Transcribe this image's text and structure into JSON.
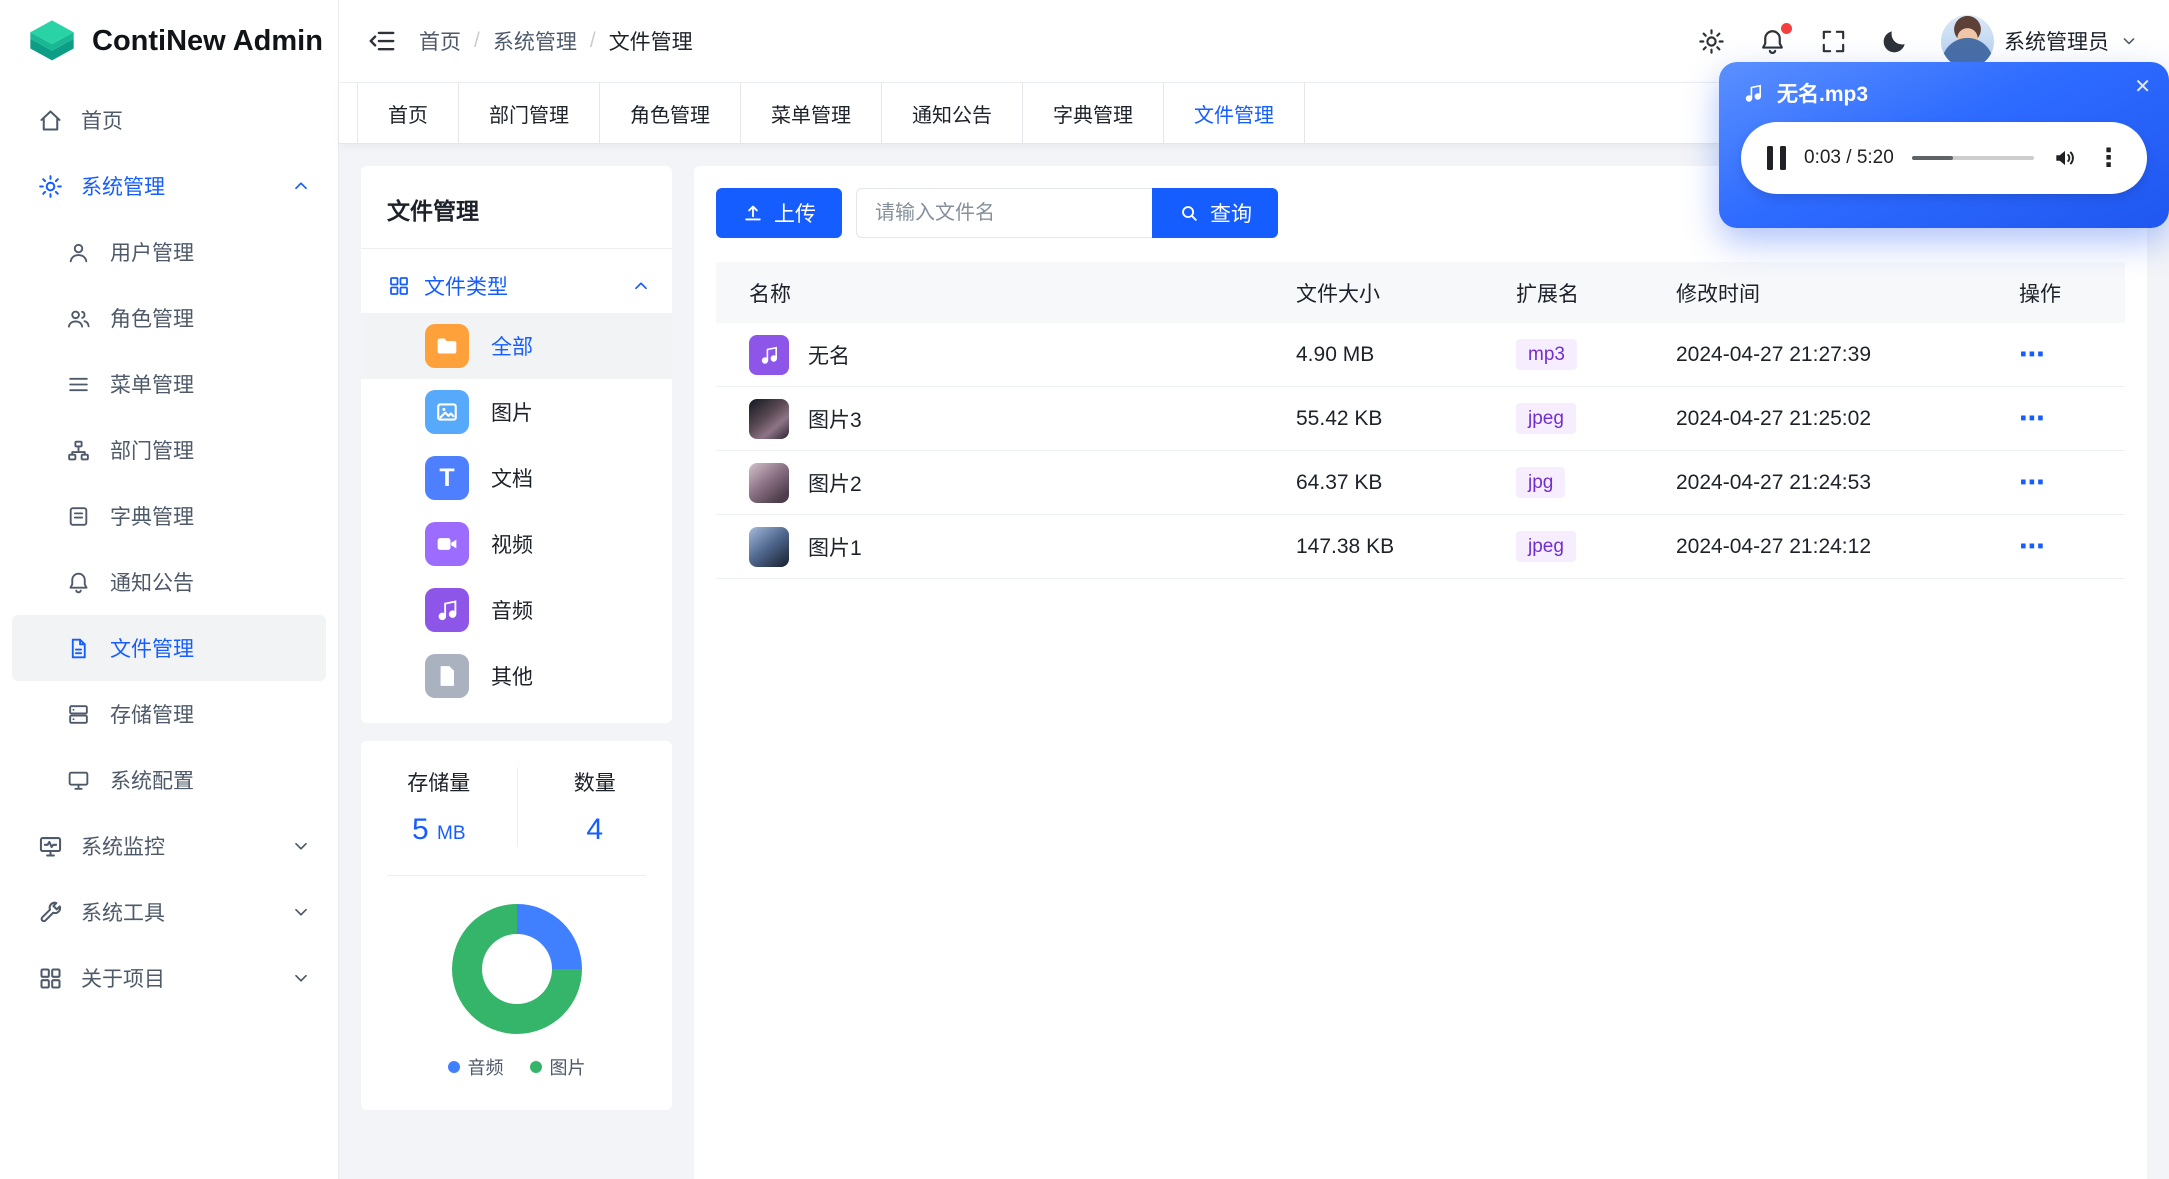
{
  "app": {
    "title": "ContiNew Admin"
  },
  "header": {
    "breadcrumb": [
      "首页",
      "系统管理",
      "文件管理"
    ],
    "separator": "/",
    "user_name": "系统管理员"
  },
  "tabs": [
    "首页",
    "部门管理",
    "角色管理",
    "菜单管理",
    "通知公告",
    "字典管理",
    "文件管理"
  ],
  "active_tab": "文件管理",
  "sidebar": {
    "items": [
      {
        "label": "首页"
      },
      {
        "label": "系统管理"
      },
      {
        "label": "用户管理"
      },
      {
        "label": "角色管理"
      },
      {
        "label": "菜单管理"
      },
      {
        "label": "部门管理"
      },
      {
        "label": "字典管理"
      },
      {
        "label": "通知公告"
      },
      {
        "label": "文件管理"
      },
      {
        "label": "存储管理"
      },
      {
        "label": "系统配置"
      },
      {
        "label": "系统监控"
      },
      {
        "label": "系统工具"
      },
      {
        "label": "关于项目"
      }
    ],
    "active_item": "文件管理",
    "expanded_group": "系统管理"
  },
  "file_panel": {
    "title": "文件管理",
    "group_label": "文件类型",
    "types": [
      {
        "label": "全部"
      },
      {
        "label": "图片"
      },
      {
        "label": "文档"
      },
      {
        "label": "视频"
      },
      {
        "label": "音频"
      },
      {
        "label": "其他"
      }
    ],
    "active_type": "全部"
  },
  "stats": {
    "storage_label": "存储量",
    "storage_value": "5",
    "storage_unit": "MB",
    "count_label": "数量",
    "count_value": "4"
  },
  "chart_data": {
    "type": "pie",
    "donut": true,
    "categories": [
      "音频",
      "图片"
    ],
    "values": [
      1,
      3
    ],
    "colors": [
      "#4080ff",
      "#34b56a"
    ],
    "legend_position": "bottom"
  },
  "toolbar": {
    "upload_label": "上传",
    "search_placeholder": "请输入文件名",
    "search_value": "",
    "query_label": "查询"
  },
  "table": {
    "columns": [
      "名称",
      "文件大小",
      "扩展名",
      "修改时间",
      "操作"
    ],
    "rows": [
      {
        "name": "无名",
        "size": "4.90 MB",
        "ext": "mp3",
        "time": "2024-04-27 21:27:39"
      },
      {
        "name": "图片3",
        "size": "55.42 KB",
        "ext": "jpeg",
        "time": "2024-04-27 21:25:02"
      },
      {
        "name": "图片2",
        "size": "64.37 KB",
        "ext": "jpg",
        "time": "2024-04-27 21:24:53"
      },
      {
        "name": "图片1",
        "size": "147.38 KB",
        "ext": "jpeg",
        "time": "2024-04-27 21:24:12"
      }
    ]
  },
  "player": {
    "title": "无名.mp3",
    "time_display": "0:03 / 5:20"
  },
  "icons": {
    "more": "⋯",
    "close": "✕",
    "kebab": "⋮",
    "doc_glyph": "T"
  },
  "colors": {
    "primary": "#165dff",
    "tag_text": "#722ed1",
    "tag_bg": "#f6eeff",
    "donut_audio": "#4080ff",
    "donut_image": "#34b56a"
  }
}
